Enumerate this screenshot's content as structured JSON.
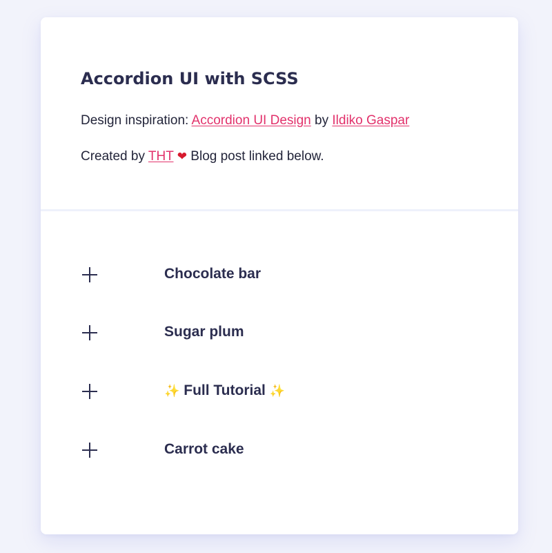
{
  "intro": {
    "title": "Accordion UI with SCSS",
    "inspiration_prefix": "Design inspiration: ",
    "inspiration_link": "Accordion UI Design",
    "by_text": " by ",
    "author_link": "Ildiko Gaspar",
    "created_prefix": "Created by ",
    "creator_link": "THT",
    "heart_glyph": "❤",
    "created_suffix": " Blog post linked below."
  },
  "accordion": {
    "items": [
      {
        "label": "Chocolate bar",
        "icon": "plus-icon"
      },
      {
        "label": "Sugar plum",
        "icon": "plus-icon"
      },
      {
        "label": " Full Tutorial ",
        "icon": "plus-icon",
        "decoration": "✨"
      },
      {
        "label": "Carrot cake",
        "icon": "plus-icon"
      }
    ]
  },
  "colors": {
    "background": "#f2f3fb",
    "card": "#ffffff",
    "text": "#2b2d4f",
    "link": "#e2316b",
    "heart": "#d7192d",
    "sparkle": "#f2c12e"
  }
}
